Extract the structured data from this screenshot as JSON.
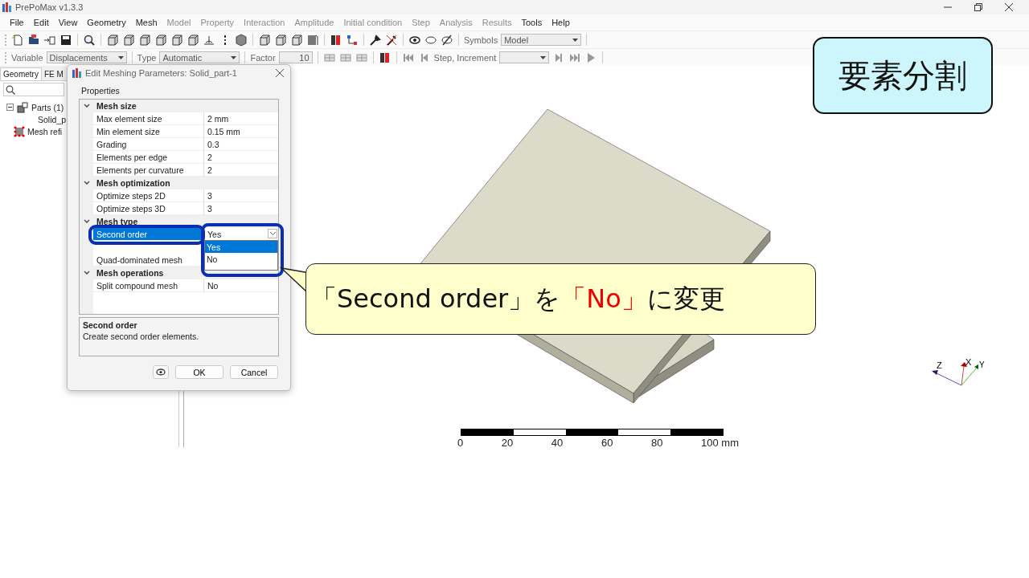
{
  "window": {
    "title": "PrePoMax v1.3.3"
  },
  "menu": [
    {
      "label": "File",
      "disabled": false
    },
    {
      "label": "Edit",
      "disabled": false
    },
    {
      "label": "View",
      "disabled": false
    },
    {
      "label": "Geometry",
      "disabled": false
    },
    {
      "label": "Mesh",
      "disabled": false
    },
    {
      "label": "Model",
      "disabled": true
    },
    {
      "label": "Property",
      "disabled": true
    },
    {
      "label": "Interaction",
      "disabled": true
    },
    {
      "label": "Amplitude",
      "disabled": true
    },
    {
      "label": "Initial condition",
      "disabled": true
    },
    {
      "label": "Step",
      "disabled": true
    },
    {
      "label": "Analysis",
      "disabled": true
    },
    {
      "label": "Results",
      "disabled": true
    },
    {
      "label": "Tools",
      "disabled": false
    },
    {
      "label": "Help",
      "disabled": false
    }
  ],
  "toolbar": {
    "symbols_label": "Symbols",
    "symbols_value": "Model"
  },
  "results_toolbar": {
    "variable_label": "Variable",
    "variable_value": "Displacements",
    "type_label": "Type",
    "type_value": "Automatic",
    "factor_label": "Factor",
    "factor_value": "10",
    "step_label": "Step, Increment"
  },
  "sidebar": {
    "tabs": [
      {
        "label": "Geometry",
        "selected": true
      },
      {
        "label": "FE M",
        "selected": false
      }
    ],
    "tree": [
      {
        "label": "Parts (1)",
        "kind": "parts",
        "expanded": true,
        "children": [
          {
            "label": "Solid_p"
          }
        ]
      },
      {
        "label": "Mesh refi",
        "kind": "mesh"
      }
    ]
  },
  "dialog": {
    "title": "Edit Meshing Parameters: Solid_part-1",
    "group": "Properties",
    "categories": [
      {
        "name": "Mesh size",
        "expanded": true,
        "rows": [
          {
            "name": "Max element size",
            "value": "2 mm",
            "selected": false
          },
          {
            "name": "Min element size",
            "value": "0.15 mm",
            "selected": false
          },
          {
            "name": "Grading",
            "value": "0.3",
            "selected": false
          },
          {
            "name": "Elements per edge",
            "value": "2",
            "selected": false
          },
          {
            "name": "Elements per curvature",
            "value": "2",
            "selected": false
          }
        ]
      },
      {
        "name": "Mesh optimization",
        "expanded": true,
        "rows": [
          {
            "name": "Optimize steps 2D",
            "value": "3",
            "selected": false
          },
          {
            "name": "Optimize steps 3D",
            "value": "3",
            "selected": false
          }
        ]
      },
      {
        "name": "Mesh type",
        "expanded": true,
        "rows": [
          {
            "name": "Second order",
            "value": "Yes",
            "selected": true
          },
          {
            "name": "Quad-dominated mesh",
            "selected": false
          }
        ]
      },
      {
        "name": "Mesh operations",
        "expanded": true,
        "rows": [
          {
            "name": "Split compound mesh",
            "value": "No",
            "selected": false
          }
        ]
      }
    ],
    "dropdown": [
      {
        "label": "Yes",
        "selected": true
      },
      {
        "label": "No",
        "selected": false
      }
    ],
    "description": {
      "title": "Second order",
      "text": "Create second order elements."
    },
    "buttons": [
      "OK",
      "Cancel"
    ]
  },
  "viewport": {
    "scale_labels": [
      "0",
      "20",
      "40",
      "60",
      "80",
      "100 mm"
    ],
    "axes": [
      "Z",
      "X",
      "Y"
    ]
  },
  "annotations": {
    "title": "要素分割",
    "callout": [
      {
        "text": "「Second order」を",
        "emphasis": false
      },
      {
        "text": "「No」",
        "emphasis": true
      },
      {
        "text": "に変更",
        "emphasis": false
      }
    ]
  }
}
